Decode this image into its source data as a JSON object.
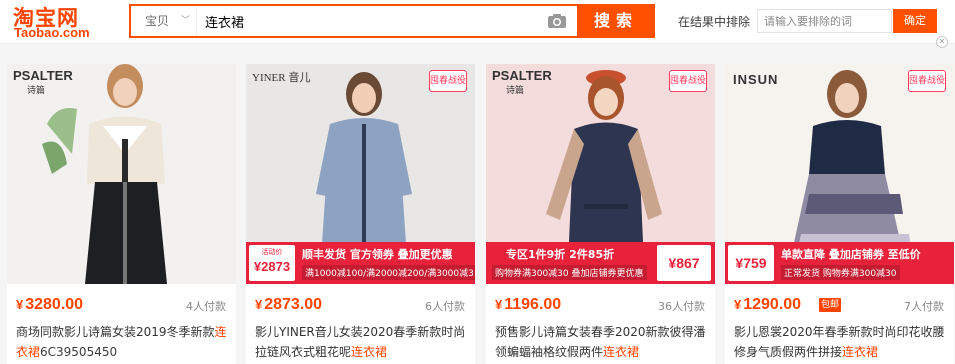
{
  "logo": {
    "cn": "淘宝网",
    "en": "Taobao.com"
  },
  "search": {
    "category": "宝贝",
    "query": "连衣裙",
    "button": "搜索"
  },
  "exclude": {
    "label": "在结果中排除",
    "placeholder": "请输入要排除的词",
    "button": "确定"
  },
  "products": [
    {
      "brand": "PSALTER",
      "brand_cn": "诗篇",
      "price": "3280.00",
      "currency": "¥",
      "sales": "4人付款",
      "title_pre": "商场同款影儿诗篇女装2019冬季新款",
      "title_hl": "连衣裙",
      "title_post": "6C39505450"
    },
    {
      "brand": "YINER 音儿",
      "badge": "囤春战役",
      "promo_label": "活动价",
      "promo_price": "2873",
      "promo_l1": "顺丰发货  官方领券  叠加更优惠",
      "promo_l2": "满1000减100/满2000减200/满3000减3",
      "price": "2873.00",
      "currency": "¥",
      "sales": "6人付款",
      "title_pre": "影儿YINER音儿女装2020春季新款时尚拉链风衣式粗花呢",
      "title_hl": "连衣裙",
      "title_post": ""
    },
    {
      "brand": "PSALTER",
      "brand_cn": "诗篇",
      "badge": "囤春战役",
      "promo_label": "",
      "promo_price": "867",
      "promo_l1": "专区1件9折  2件85折",
      "promo_l2": "购物券满300减30 叠加店铺券更优惠",
      "price": "1196.00",
      "currency": "¥",
      "sales": "36人付款",
      "title_pre": "预售影儿诗篇女装春季2020新款彼得潘领蝙蝠袖格纹假两件",
      "title_hl": "连衣裙",
      "title_post": ""
    },
    {
      "brand": "INSUN",
      "badge": "囤春战役",
      "promo_label": "",
      "promo_price": "759",
      "promo_l1": "单款直降  叠加店铺券  至低价",
      "promo_l2": "正常发货  购物券满300减30",
      "price": "1290.00",
      "currency": "¥",
      "sales": "7人付款",
      "baoyou": "包邮",
      "title_pre": "影儿恩裳2020年春季新款时尚印花收腰修身气质假两件拼接",
      "title_hl": "连衣裙",
      "title_post": ""
    }
  ],
  "colors": {
    "accent": "#ff5000",
    "price": "#ff4400",
    "promo": "#e8223a"
  }
}
